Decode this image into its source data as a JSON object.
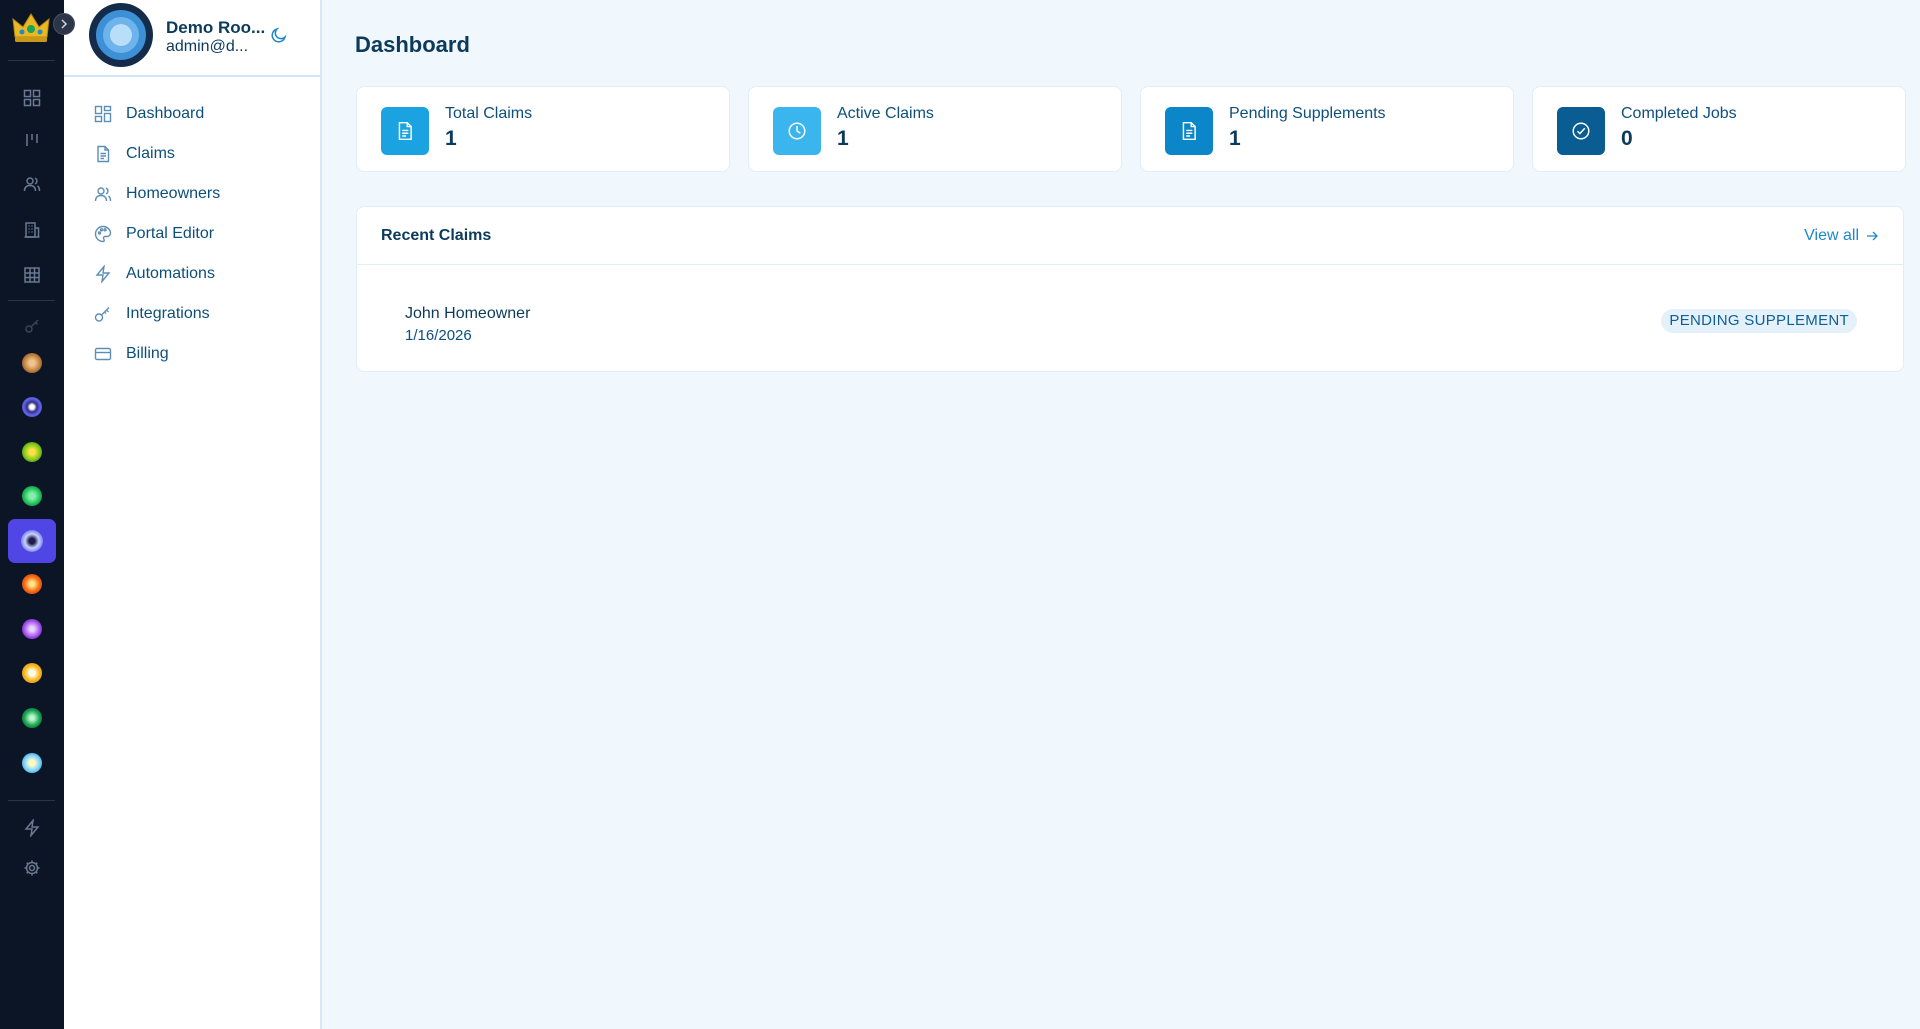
{
  "colors": {
    "rail_bg": "#0b1526",
    "accent": "#4f46e5",
    "page_bg": "#f0f7fd",
    "text_primary": "#0c3a5a",
    "text_link": "#1f87c9"
  },
  "rail": {
    "nav_icons": [
      "grid-icon",
      "kanban-icon",
      "users-icon",
      "building-icon",
      "table-icon"
    ],
    "workspace_orbs": [
      {
        "name": "workspace-orb-muted",
        "color": "#3a4456"
      },
      {
        "name": "workspace-orb-amber",
        "color": "#c68a45"
      },
      {
        "name": "workspace-orb-indigo",
        "color": "#6366f1"
      },
      {
        "name": "workspace-orb-lime",
        "color": "#84cc16"
      },
      {
        "name": "workspace-orb-green",
        "color": "#22c55e"
      },
      {
        "name": "workspace-orb-active",
        "color": "#c7d2fe"
      },
      {
        "name": "workspace-orb-orange",
        "color": "#f97316"
      },
      {
        "name": "workspace-orb-purple",
        "color": "#a855f7"
      },
      {
        "name": "workspace-orb-yellow",
        "color": "#fbbf24"
      },
      {
        "name": "workspace-orb-emerald",
        "color": "#16a34a"
      },
      {
        "name": "workspace-orb-sky",
        "color": "#7dd3fc"
      }
    ],
    "bottom_icons": [
      "lightning-icon",
      "settings-gear-icon"
    ]
  },
  "profile": {
    "name": "Demo Roo...",
    "email": "admin@d..."
  },
  "nav": {
    "items": [
      {
        "label": "Dashboard",
        "icon": "dashboard-grid-icon"
      },
      {
        "label": "Claims",
        "icon": "document-icon"
      },
      {
        "label": "Homeowners",
        "icon": "users-icon"
      },
      {
        "label": "Portal Editor",
        "icon": "palette-icon"
      },
      {
        "label": "Automations",
        "icon": "lightning-icon"
      },
      {
        "label": "Integrations",
        "icon": "key-icon"
      },
      {
        "label": "Billing",
        "icon": "credit-card-icon"
      }
    ]
  },
  "main": {
    "title": "Dashboard",
    "stats": [
      {
        "label": "Total Claims",
        "value": "1",
        "icon": "document-icon",
        "color": "#1aa3e0"
      },
      {
        "label": "Active Claims",
        "value": "1",
        "icon": "clock-icon",
        "color": "#3bb5ee"
      },
      {
        "label": "Pending Supplements",
        "value": "1",
        "icon": "document-icon",
        "color": "#0b86c8"
      },
      {
        "label": "Completed Jobs",
        "value": "0",
        "icon": "check-circle-icon",
        "color": "#0a5d93"
      }
    ],
    "recent": {
      "title": "Recent Claims",
      "view_all": "View all",
      "claims": [
        {
          "name": "John Homeowner",
          "date": "1/16/2026",
          "status": "PENDING SUPPLEMENT"
        }
      ]
    }
  }
}
